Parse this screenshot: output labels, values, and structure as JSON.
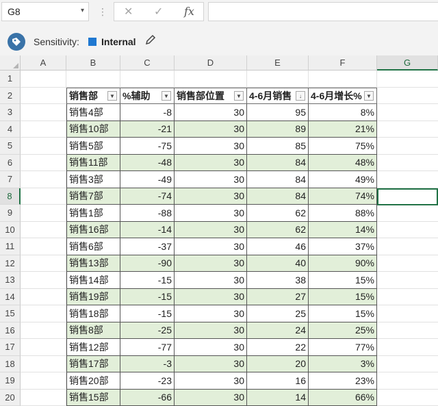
{
  "formula_bar": {
    "name_box": "G8",
    "cancel_icon": "✕",
    "enter_icon": "✓",
    "fx_label": "fx",
    "formula": ""
  },
  "sensitivity": {
    "label": "Sensitivity:",
    "value": "Internal"
  },
  "columns": [
    "A",
    "B",
    "C",
    "D",
    "E",
    "F",
    "G"
  ],
  "rows": [
    "1",
    "2",
    "3",
    "4",
    "5",
    "6",
    "7",
    "8",
    "9",
    "10",
    "11",
    "12",
    "13",
    "14",
    "15",
    "16",
    "17",
    "18",
    "19",
    "20"
  ],
  "table": {
    "headers": [
      "销售部",
      "%辅助",
      "销售部位置",
      "4-6月销售",
      "4-6月增长%"
    ],
    "data": [
      [
        "销售4部",
        "-8",
        "30",
        "95",
        "8%"
      ],
      [
        "销售10部",
        "-21",
        "30",
        "89",
        "21%"
      ],
      [
        "销售5部",
        "-75",
        "30",
        "85",
        "75%"
      ],
      [
        "销售11部",
        "-48",
        "30",
        "84",
        "48%"
      ],
      [
        "销售3部",
        "-49",
        "30",
        "84",
        "49%"
      ],
      [
        "销售7部",
        "-74",
        "30",
        "84",
        "74%"
      ],
      [
        "销售1部",
        "-88",
        "30",
        "62",
        "88%"
      ],
      [
        "销售16部",
        "-14",
        "30",
        "62",
        "14%"
      ],
      [
        "销售6部",
        "-37",
        "30",
        "46",
        "37%"
      ],
      [
        "销售13部",
        "-90",
        "30",
        "40",
        "90%"
      ],
      [
        "销售14部",
        "-15",
        "30",
        "38",
        "15%"
      ],
      [
        "销售19部",
        "-15",
        "30",
        "27",
        "15%"
      ],
      [
        "销售18部",
        "-15",
        "30",
        "25",
        "15%"
      ],
      [
        "销售8部",
        "-25",
        "30",
        "24",
        "25%"
      ],
      [
        "销售12部",
        "-77",
        "30",
        "22",
        "77%"
      ],
      [
        "销售17部",
        "-3",
        "30",
        "20",
        "3%"
      ],
      [
        "销售20部",
        "-23",
        "30",
        "16",
        "23%"
      ],
      [
        "销售15部",
        "-66",
        "30",
        "14",
        "66%"
      ]
    ]
  },
  "colors": {
    "band": "#e2efd9",
    "accent": "#217346",
    "sensitivity_badge": "#1f78d1"
  }
}
